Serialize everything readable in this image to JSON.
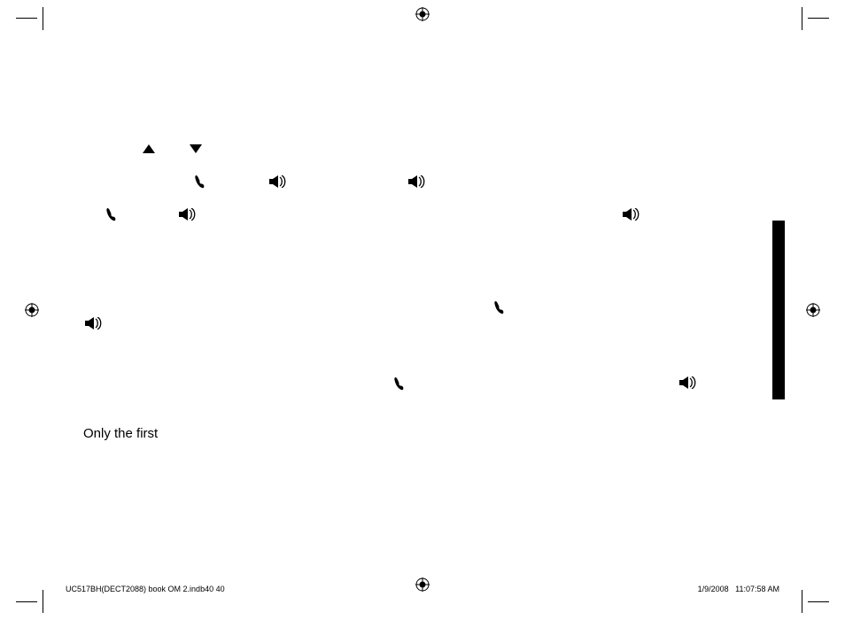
{
  "body_text": "Only the first",
  "footer": {
    "left": "UC517BH(DECT2088) book OM 2.indb40   40",
    "date": "1/9/2008",
    "time": "11:07:58 AM"
  }
}
